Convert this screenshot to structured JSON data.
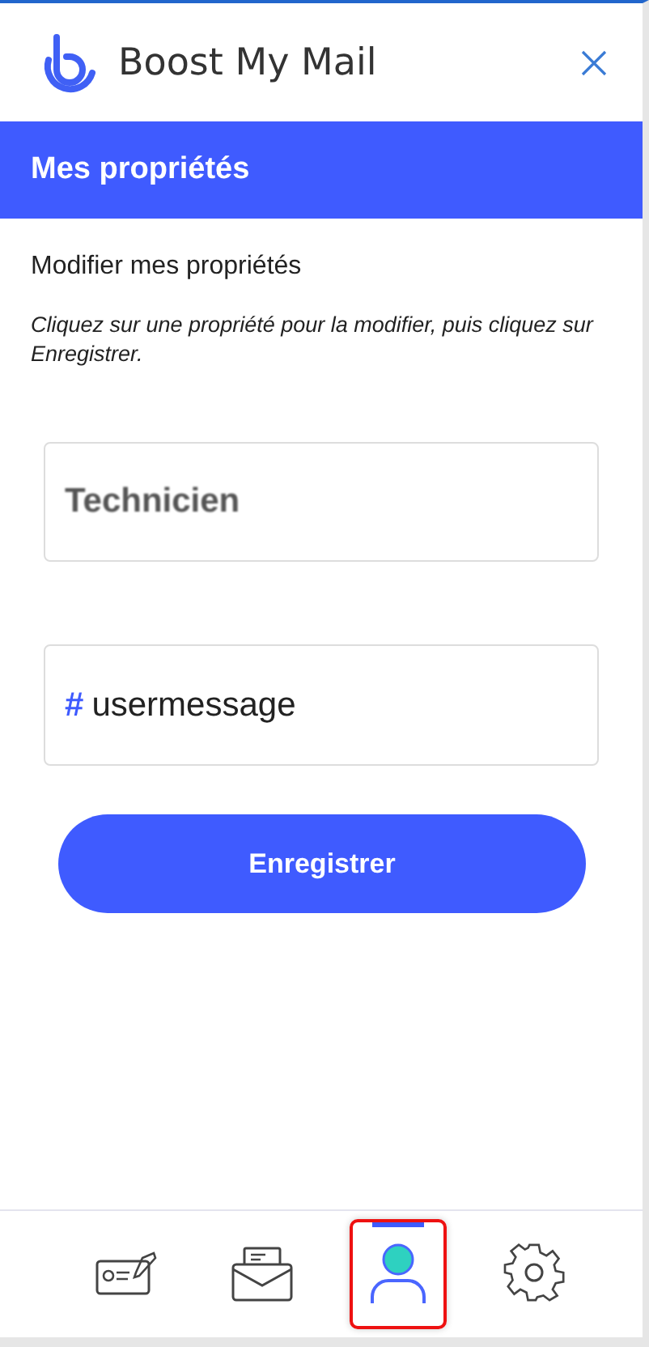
{
  "header": {
    "title": "Boost My Mail"
  },
  "section": {
    "title": "Mes propriétés"
  },
  "subtitle": "Modifier mes propriétés",
  "instructions": "Cliquez sur une propriété pour la modifier, puis cliquez sur Enregistrer.",
  "fields": [
    {
      "kind": "plain",
      "value": "Technicien"
    },
    {
      "kind": "tag",
      "prefix": "#",
      "value": "usermessage"
    }
  ],
  "save_button": "Enregistrer",
  "nav": [
    {
      "kind": "card",
      "selected": false
    },
    {
      "kind": "mail",
      "selected": false
    },
    {
      "kind": "user",
      "selected": true
    },
    {
      "kind": "gear",
      "selected": false
    }
  ]
}
